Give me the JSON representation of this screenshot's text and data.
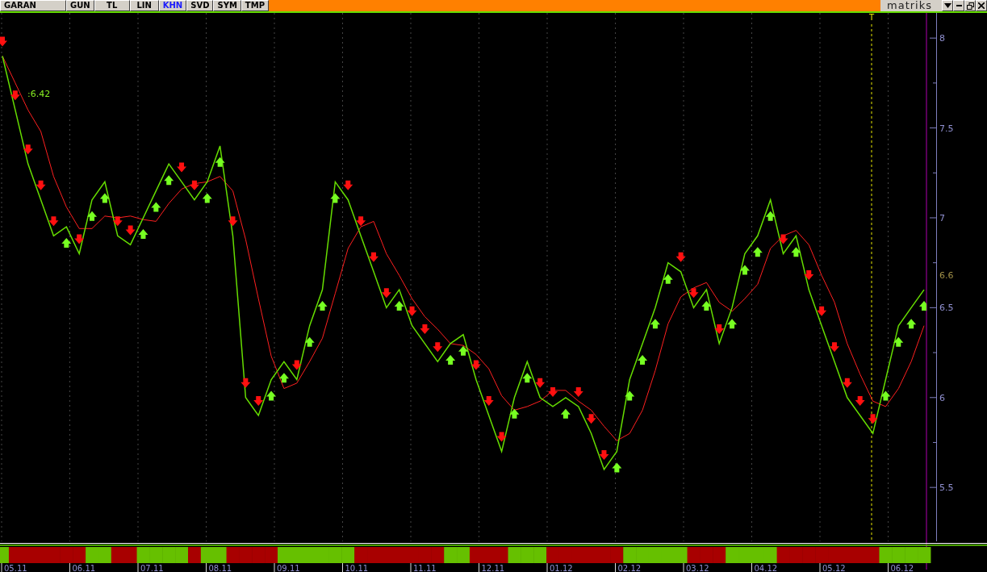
{
  "toolbar": {
    "tabs": [
      {
        "label": "GARAN",
        "selected": false
      },
      {
        "label": "GUN",
        "selected": false
      },
      {
        "label": "TL",
        "selected": false
      },
      {
        "label": "LIN",
        "selected": false
      },
      {
        "label": "KHN",
        "selected": true
      },
      {
        "label": "SVD",
        "selected": false
      },
      {
        "label": "SYM",
        "selected": false
      },
      {
        "label": "TMP",
        "selected": false
      }
    ],
    "logo": "matriks"
  },
  "chart": {
    "current_label": "6.6",
    "value_label": ":6.42",
    "marker_label": "T",
    "date_labels": [
      "05.11",
      "06.11",
      "07.11",
      "08.11",
      "09.11",
      "10.11",
      "11.11",
      "12.11",
      "01.12",
      "02.12",
      "03.12",
      "04.12",
      "05.12",
      "06.12"
    ],
    "chart_data": {
      "type": "line",
      "grid": true,
      "ylim": [
        5.2,
        8.14
      ],
      "yticks": [
        5.5,
        6,
        6.5,
        7,
        7.5,
        8
      ],
      "series": [
        {
          "color": "#66dd00",
          "values": [
            7.9,
            7.6,
            7.3,
            7.1,
            6.9,
            6.95,
            6.8,
            7.1,
            7.2,
            6.9,
            6.85,
            7.0,
            7.15,
            7.3,
            7.2,
            7.1,
            7.2,
            7.4,
            6.9,
            6.0,
            5.9,
            6.1,
            6.2,
            6.1,
            6.4,
            6.6,
            7.2,
            7.1,
            6.9,
            6.7,
            6.5,
            6.6,
            6.4,
            6.3,
            6.2,
            6.3,
            6.35,
            6.1,
            5.9,
            5.7,
            6.0,
            6.2,
            6.0,
            5.95,
            6.0,
            5.95,
            5.8,
            5.6,
            5.7,
            6.1,
            6.3,
            6.5,
            6.75,
            6.7,
            6.5,
            6.6,
            6.3,
            6.5,
            6.8,
            6.9,
            7.1,
            6.8,
            6.9,
            6.6,
            6.4,
            6.2,
            6.0,
            5.9,
            5.8,
            6.1,
            6.4,
            6.5,
            6.6
          ]
        },
        {
          "color": "#ff2020",
          "values": [
            7.9,
            7.75,
            7.6,
            7.48,
            7.23,
            7.06,
            6.94,
            6.94,
            7.01,
            7.0,
            7.01,
            6.99,
            6.98,
            7.08,
            7.16,
            7.19,
            7.2,
            7.23,
            7.15,
            6.88,
            6.55,
            6.23,
            6.05,
            6.08,
            6.2,
            6.33,
            6.58,
            6.83,
            6.95,
            6.98,
            6.8,
            6.68,
            6.55,
            6.45,
            6.38,
            6.3,
            6.29,
            6.24,
            6.16,
            6.01,
            5.93,
            5.95,
            5.98,
            6.04,
            6.04,
            5.98,
            5.93,
            5.84,
            5.76,
            5.8,
            5.93,
            6.15,
            6.41,
            6.56,
            6.61,
            6.64,
            6.53,
            6.48,
            6.55,
            6.63,
            6.83,
            6.9,
            6.93,
            6.85,
            6.68,
            6.53,
            6.3,
            6.13,
            5.98,
            5.95,
            6.05,
            6.2,
            6.4
          ]
        }
      ]
    }
  }
}
